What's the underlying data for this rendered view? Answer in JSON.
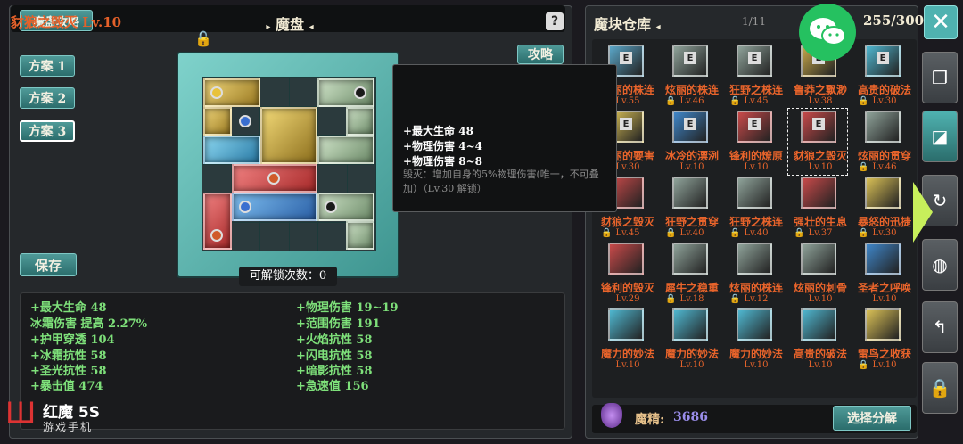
{
  "left_panel": {
    "guide_label": "魔盘攻略",
    "title": "魔盘",
    "help_icon": "help-icon",
    "plans": [
      "方案 1",
      "方案 2",
      "方案 3"
    ],
    "selected_plan": 2,
    "save_label": "保存",
    "strategy_label": "攻略",
    "unlock_count": "可解锁次数：0"
  },
  "stats_left": [
    "+最大生命 48",
    "冰霜伤害 提高 2.27%",
    "+护甲穿透 104",
    "+冰霜抗性 58",
    "+圣光抗性 58",
    "+暴击值 474"
  ],
  "stats_right": [
    "+物理伤害 19~19",
    "+范围伤害 191",
    "+火焰抗性 58",
    "+闪电抗性 58",
    "+暗影抗性 58",
    "+急速值 156"
  ],
  "tooltip": {
    "title": "豺狼之毁灭  Lv.10",
    "lines": [
      "+最大生命  48",
      "+物理伤害  4~4",
      "+物理伤害  8~8"
    ],
    "desc": "毁灭：增加自身的5%物理伤害(唯一，不可叠加）（Lv.30 解锁）"
  },
  "warehouse": {
    "title": "魔块仓库",
    "page": "1/11",
    "capacity": "255/300",
    "items": [
      {
        "name": "炫丽的株连",
        "lv": "Lv.55",
        "color": "#5ba7c9",
        "e": true,
        "lock": false
      },
      {
        "name": "炫丽的株连",
        "lv": "Lv.46",
        "color": "#8fa39a",
        "e": true,
        "lock": true
      },
      {
        "name": "狂野之株连",
        "lv": "Lv.45",
        "color": "#8fa39a",
        "e": true,
        "lock": true
      },
      {
        "name": "鲁莽之飘渺",
        "lv": "Lv.38",
        "color": "#c9a94a",
        "e": true,
        "lock": false
      },
      {
        "name": "高贵的破法",
        "lv": "Lv.30",
        "color": "#4fb7d0",
        "e": true,
        "lock": true
      },
      {
        "name": "炫丽的要害",
        "lv": "Lv.30",
        "color": "#d9c056",
        "e": true,
        "lock": false
      },
      {
        "name": "冰冷的漂洌",
        "lv": "Lv.10",
        "color": "#3f86c9",
        "e": true,
        "lock": false
      },
      {
        "name": "锋利的燎原",
        "lv": "Lv.10",
        "color": "#c94a4a",
        "e": true,
        "lock": false
      },
      {
        "name": "豺狼之毁灭",
        "lv": "Lv.10",
        "color": "#c94a4a",
        "e": true,
        "lock": false
      },
      {
        "name": "炫丽的贯穿",
        "lv": "Lv.46",
        "color": "#8fa39a",
        "e": false,
        "lock": true
      },
      {
        "name": "豺狼之毁灭",
        "lv": "Lv.45",
        "color": "#c94a4a",
        "e": false,
        "lock": true
      },
      {
        "name": "狂野之贯穿",
        "lv": "Lv.40",
        "color": "#8fa39a",
        "e": false,
        "lock": true
      },
      {
        "name": "狂野之株连",
        "lv": "Lv.40",
        "color": "#8fa39a",
        "e": false,
        "lock": true
      },
      {
        "name": "强壮的生息",
        "lv": "Lv.37",
        "color": "#c94a4a",
        "e": false,
        "lock": true
      },
      {
        "name": "暴怒的迅捷",
        "lv": "Lv.30",
        "color": "#d9c056",
        "e": false,
        "lock": true
      },
      {
        "name": "锋利的毁灭",
        "lv": "Lv.29",
        "color": "#c94a4a",
        "e": false,
        "lock": false
      },
      {
        "name": "犀牛之稳重",
        "lv": "Lv.18",
        "color": "#8fa39a",
        "e": false,
        "lock": true
      },
      {
        "name": "炫丽的株连",
        "lv": "Lv.12",
        "color": "#8fa39a",
        "e": false,
        "lock": true
      },
      {
        "name": "炫丽的刺骨",
        "lv": "Lv.10",
        "color": "#8fa39a",
        "e": false,
        "lock": false
      },
      {
        "name": "圣者之呼唤",
        "lv": "Lv.10",
        "color": "#3f86c9",
        "e": false,
        "lock": false
      },
      {
        "name": "魔力的妙法",
        "lv": "Lv.10",
        "color": "#4fb7d0",
        "e": false,
        "lock": false
      },
      {
        "name": "魔力的妙法",
        "lv": "Lv.10",
        "color": "#4fb7d0",
        "e": false,
        "lock": false
      },
      {
        "name": "魔力的妙法",
        "lv": "Lv.10",
        "color": "#4fb7d0",
        "e": false,
        "lock": false
      },
      {
        "name": "高贵的破法",
        "lv": "Lv.10",
        "color": "#4fb7d0",
        "e": false,
        "lock": false
      },
      {
        "name": "雷鸟之收获",
        "lv": "Lv.10",
        "color": "#d9c056",
        "e": false,
        "lock": true
      }
    ],
    "selected_index": 8
  },
  "essence": {
    "label": "魔精:",
    "value": "3686"
  },
  "decompose_label": "选择分解",
  "side_tools": [
    "close-icon",
    "stack-icon",
    "panel-icon",
    "rotate-icon",
    "orb-icon",
    "return-icon",
    "lock-icon"
  ],
  "logo": {
    "brand": "红魔 5S",
    "sub": "游戏手机"
  }
}
